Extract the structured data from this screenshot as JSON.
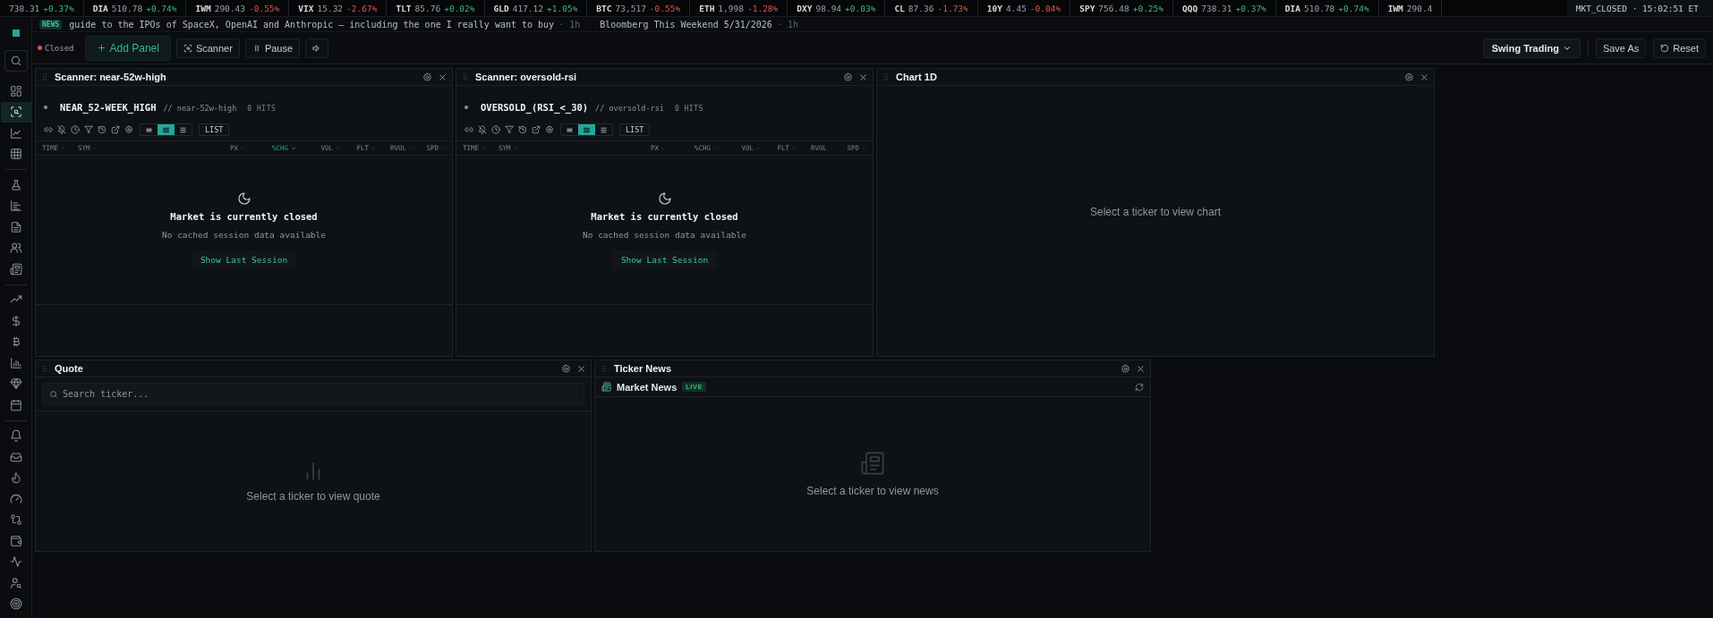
{
  "ticker": {
    "items": [
      {
        "price": "738.31",
        "change": "+0.37%",
        "up": true
      },
      {
        "symbol": "DIA",
        "price": "510.78",
        "change": "+0.74%",
        "up": true
      },
      {
        "symbol": "IWM",
        "price": "290.43",
        "change": "-0.55%",
        "up": false
      },
      {
        "symbol": "VIX",
        "price": "15.32",
        "change": "-2.67%",
        "up": false
      },
      {
        "symbol": "TLT",
        "price": "85.76",
        "change": "+0.02%",
        "up": true
      },
      {
        "symbol": "GLD",
        "price": "417.12",
        "change": "+1.05%",
        "up": true
      },
      {
        "symbol": "BTC",
        "price": "73,517",
        "change": "-0.55%",
        "up": false
      },
      {
        "symbol": "ETH",
        "price": "1,998",
        "change": "-1.28%",
        "up": false
      },
      {
        "symbol": "DXY",
        "price": "98.94",
        "change": "+0.03%",
        "up": true
      },
      {
        "symbol": "CL",
        "price": "87.36",
        "change": "-1.73%",
        "up": false
      },
      {
        "symbol": "10Y",
        "price": "4.45",
        "change": "-0.04%",
        "up": false
      },
      {
        "symbol": "SPY",
        "price": "756.48",
        "change": "+0.25%",
        "up": true
      },
      {
        "symbol": "QQQ",
        "price": "738.31",
        "change": "+0.37%",
        "up": true
      },
      {
        "symbol": "DIA",
        "price": "510.78",
        "change": "+0.74%",
        "up": true
      },
      {
        "symbol": "IWM",
        "price": "290.4"
      }
    ],
    "market_status": "MKT_CLOSED · 15:02:51 ET"
  },
  "news": {
    "badge": "NEWS",
    "items": [
      {
        "headline": "guide to the IPOs of SpaceX, OpenAI and Anthropic — including the one I really want to buy",
        "age": "· 1h"
      },
      {
        "headline": "Bloomberg This Weekend 5/31/2026",
        "age": "· 1h"
      }
    ]
  },
  "sidebar": {
    "groups": [
      {
        "items": [
          {
            "selected": false
          }
        ]
      },
      {
        "items": [
          {
            "selected": false
          },
          {
            "selected": true
          },
          {
            "selected": false
          },
          {
            "selected": false
          }
        ]
      },
      {
        "items": [
          {
            "selected": false
          },
          {
            "selected": false
          },
          {
            "selected": false
          },
          {
            "selected": false
          },
          {
            "selected": false
          }
        ]
      },
      {
        "items": [
          {
            "selected": false
          },
          {
            "selected": false
          },
          {
            "selected": false
          },
          {
            "selected": false
          },
          {
            "selected": false
          },
          {
            "selected": false
          }
        ]
      },
      {
        "items": [
          {
            "selected": false
          },
          {
            "selected": false
          },
          {
            "selected": false
          },
          {
            "selected": false
          },
          {
            "selected": false
          },
          {
            "selected": false
          },
          {
            "selected": false
          },
          {
            "selected": false
          },
          {
            "selected": false
          }
        ]
      }
    ]
  },
  "toolbar": {
    "status": {
      "label": "Closed",
      "open": false
    },
    "buttons": [
      {
        "kind": "add",
        "label": "Add Panel"
      },
      {
        "kind": "scanner",
        "label": "Scanner"
      },
      {
        "kind": "pause",
        "label": "Pause"
      },
      {
        "kind": "sound"
      }
    ],
    "layout": "Swing Trading",
    "save": "Save As",
    "reset": "Reset"
  },
  "scanners": [
    {
      "title": "Scanner: near-52w-high",
      "name": "NEAR_52-WEEK_HIGH",
      "slug": "// near-52w-high",
      "hits": "0 HITS",
      "views": [
        {
          "selected": false
        },
        {
          "selected": true
        },
        {
          "selected": false
        }
      ],
      "list_label": "LIST",
      "columns": [
        {
          "label": "TIME",
          "sorted": false
        },
        {
          "label": "SYM",
          "sorted": false
        },
        {
          "label": "PX",
          "sorted": false
        },
        {
          "label": "%CHG",
          "sorted": true
        },
        {
          "label": "VOL",
          "sorted": false
        },
        {
          "label": "FLT",
          "sorted": false
        },
        {
          "label": "RVOL",
          "sorted": false
        },
        {
          "label": "SPD",
          "sorted": false
        }
      ],
      "empty": {
        "title": "Market is currently closed",
        "message": "No cached session data available",
        "action": "Show Last Session"
      }
    },
    {
      "title": "Scanner: oversold-rsi",
      "name": "OVERSOLD_(RSI_<_30)",
      "slug": "// oversold-rsi",
      "hits": "0 HITS",
      "views": [
        {
          "selected": false
        },
        {
          "selected": true
        },
        {
          "selected": false
        }
      ],
      "list_label": "LIST",
      "columns": [
        {
          "label": "TIME",
          "sorted": false
        },
        {
          "label": "SYM",
          "sorted": false
        },
        {
          "label": "PX",
          "sorted": false
        },
        {
          "label": "%CHG",
          "sorted": false
        },
        {
          "label": "VOL",
          "sorted": false
        },
        {
          "label": "FLT",
          "sorted": false
        },
        {
          "label": "RVOL",
          "sorted": false
        },
        {
          "label": "SPD",
          "sorted": false
        }
      ],
      "empty": {
        "title": "Market is currently closed",
        "message": "No cached session data available",
        "action": "Show Last Session"
      }
    }
  ],
  "chart": {
    "title": "Chart 1D",
    "message": "Select a ticker to view chart"
  },
  "quote": {
    "title": "Quote",
    "search": {
      "placeholder": "Search ticker..."
    },
    "message": "Select a ticker to view quote"
  },
  "ticker_news": {
    "title": "Ticker News",
    "feed": "Market News",
    "badge": "LIVE",
    "message": "Select a ticker to view news"
  }
}
